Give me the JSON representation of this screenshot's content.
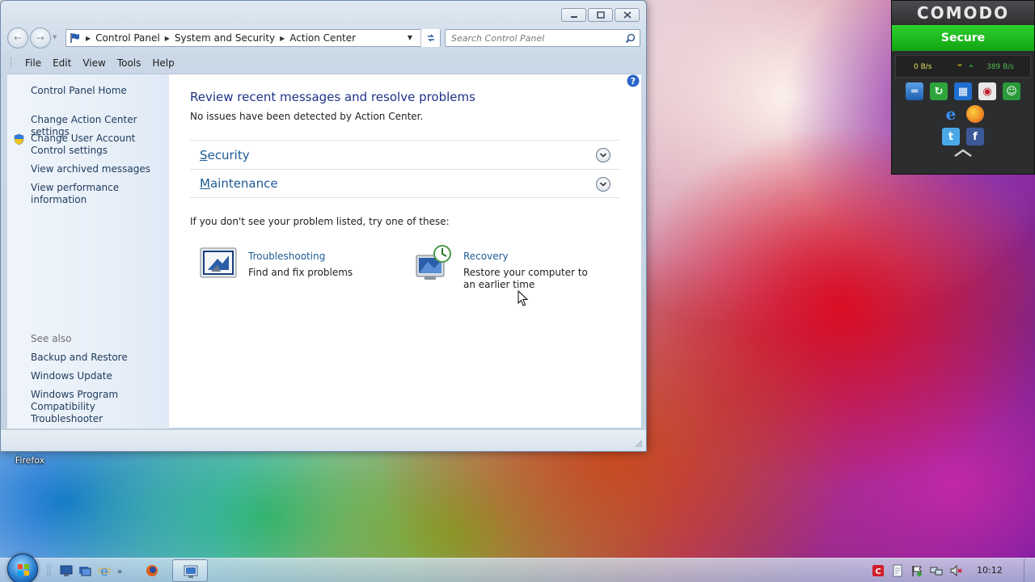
{
  "window": {
    "breadcrumb": [
      "Control Panel",
      "System and Security",
      "Action Center"
    ],
    "search_placeholder": "Search Control Panel",
    "menu": [
      "File",
      "Edit",
      "View",
      "Tools",
      "Help"
    ]
  },
  "sidebar": {
    "home": "Control Panel Home",
    "links": [
      "Change Action Center settings",
      "Change User Account Control settings",
      "View archived messages",
      "View performance information"
    ],
    "see_also_title": "See also",
    "see_also": [
      "Backup and Restore",
      "Windows Update",
      "Windows Program Compatibility Troubleshooter"
    ]
  },
  "main": {
    "title": "Review recent messages and resolve problems",
    "subtitle": "No issues have been detected by Action Center.",
    "sections": [
      {
        "first": "S",
        "rest": "ecurity"
      },
      {
        "first": "M",
        "rest": "aintenance"
      }
    ],
    "try_text": "If you don't see your problem listed, try one of these:",
    "tools": [
      {
        "link": "Troubleshooting",
        "desc": "Find and fix problems",
        "icon": "troubleshooting-icon"
      },
      {
        "link": "Recovery",
        "desc": "Restore your computer to an earlier time",
        "icon": "recovery-icon"
      }
    ]
  },
  "desktop": {
    "icon_label": "Firefox"
  },
  "comodo": {
    "logo": "COMODO",
    "status": "Secure",
    "status_color": "#1fbd1f",
    "download_rate": "0 B/s",
    "upload_rate": "389 B/s"
  },
  "taskbar": {
    "clock": "10:12"
  }
}
